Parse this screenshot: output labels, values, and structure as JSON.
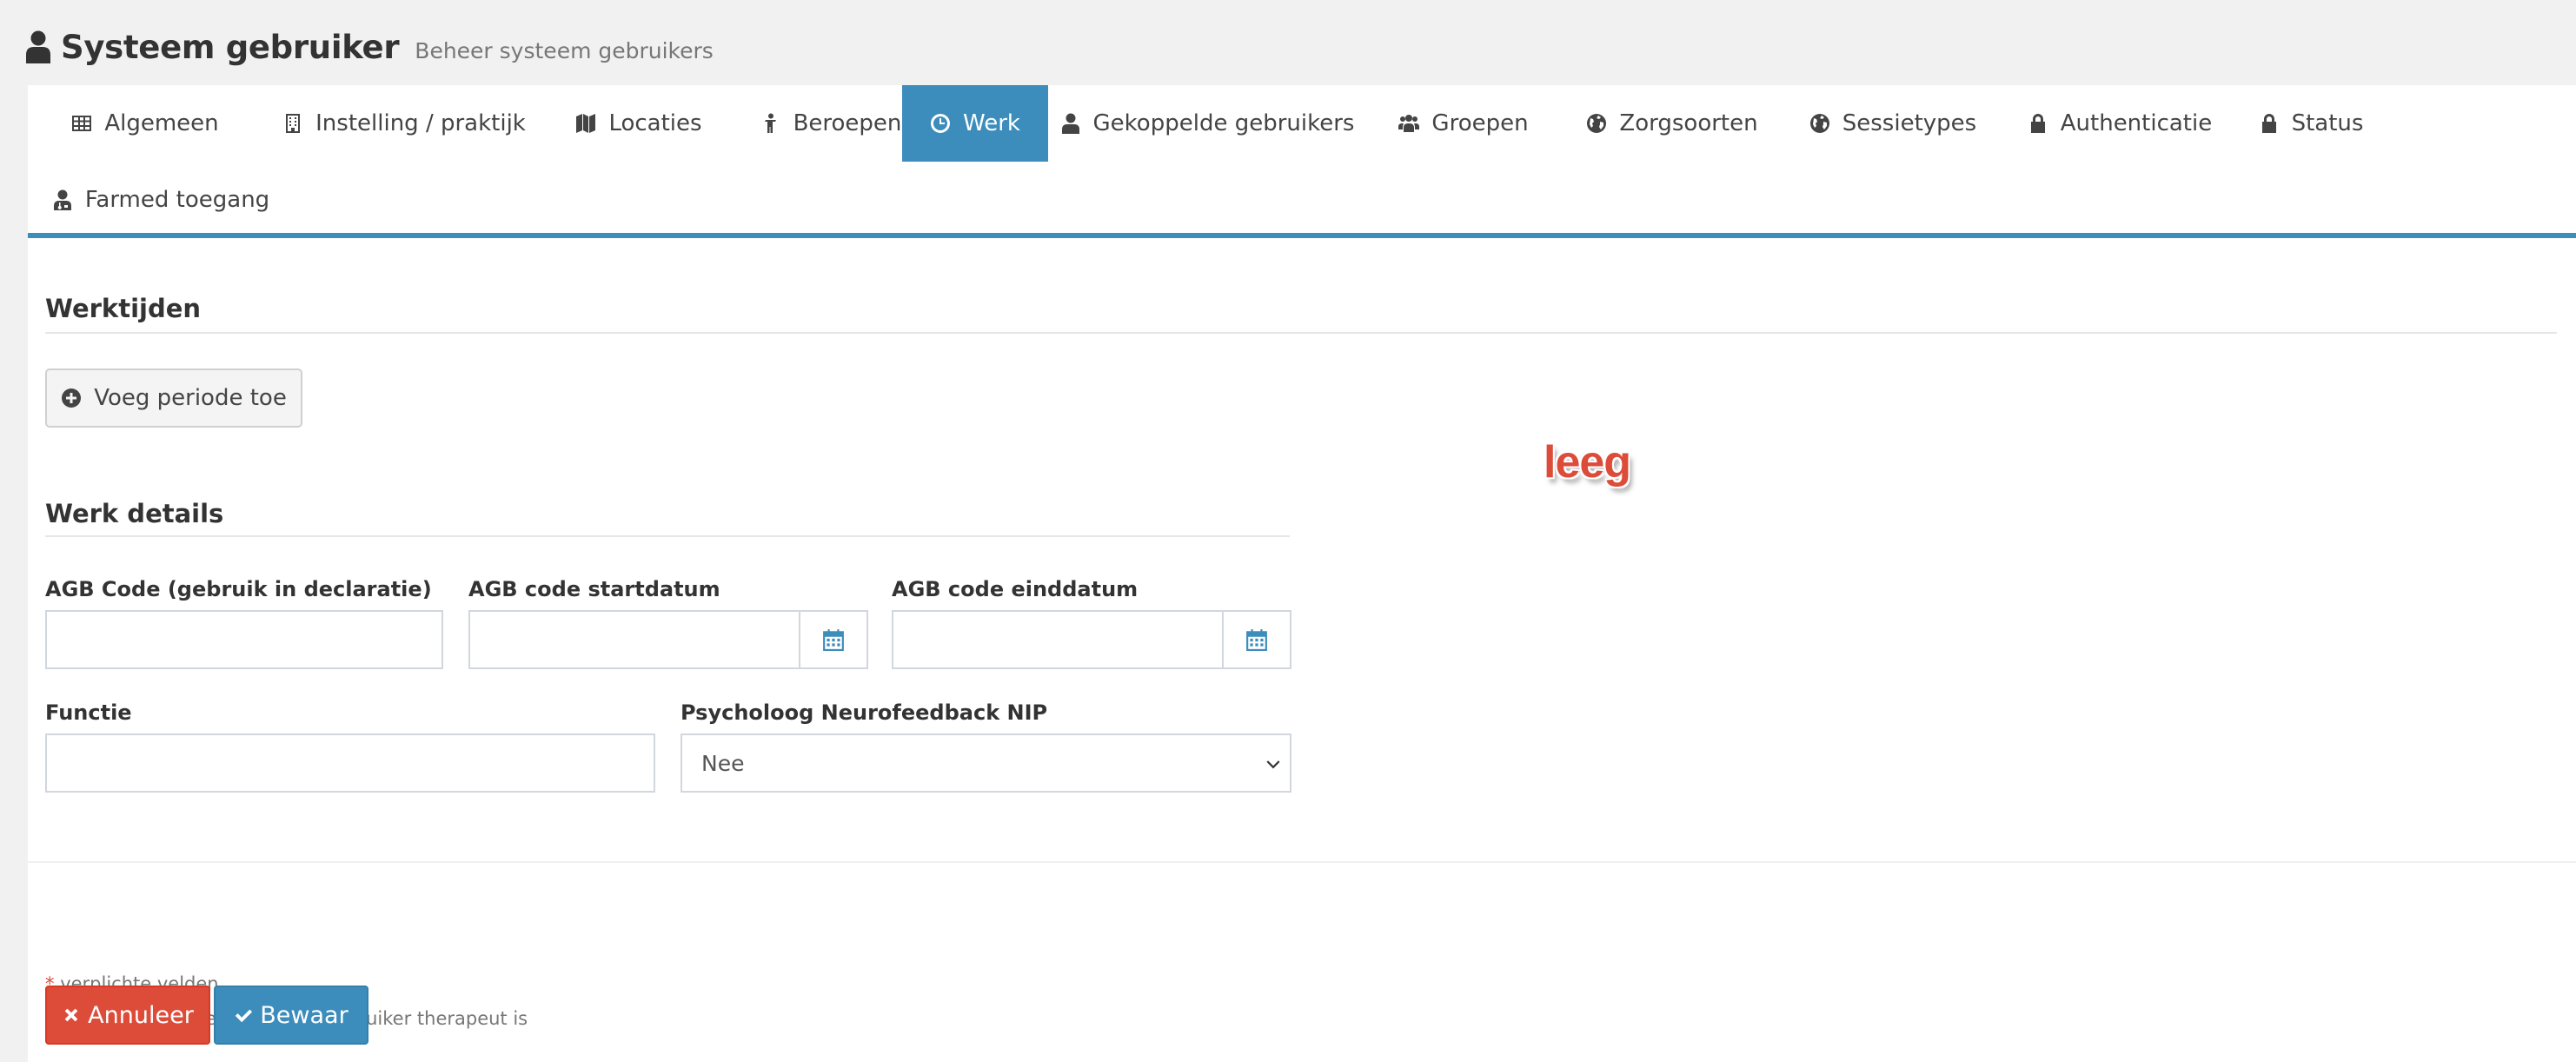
{
  "header": {
    "title": "Systeem gebruiker",
    "subtitle": "Beheer systeem gebruikers",
    "icon": "user-icon"
  },
  "tabs": [
    {
      "label": "Algemeen",
      "icon": "table-icon",
      "active": false
    },
    {
      "label": "Instelling / praktijk",
      "icon": "building-icon",
      "active": false
    },
    {
      "label": "Locaties",
      "icon": "map-icon",
      "active": false
    },
    {
      "label": "Beroepen",
      "icon": "person-icon",
      "active": false
    },
    {
      "label": "Werk",
      "icon": "clock-icon",
      "active": true
    },
    {
      "label": "Gekoppelde gebruikers",
      "icon": "user-icon",
      "active": false
    },
    {
      "label": "Groepen",
      "icon": "users-icon",
      "active": false
    },
    {
      "label": "Zorgsoorten",
      "icon": "globe-icon",
      "active": false
    },
    {
      "label": "Sessietypes",
      "icon": "globe-icon",
      "active": false
    },
    {
      "label": "Authenticatie",
      "icon": "lock-icon",
      "active": false
    },
    {
      "label": "Status",
      "icon": "lock-icon",
      "active": false
    },
    {
      "label": "Farmed toegang",
      "icon": "user-md-icon",
      "active": false
    }
  ],
  "worktimes": {
    "title": "Werktijden",
    "add_period_label": "Voeg periode toe",
    "empty_label": "leeg"
  },
  "work_details": {
    "title": "Werk details",
    "agb_code": {
      "label": "AGB Code (gebruik in declaratie)",
      "value": ""
    },
    "agb_start": {
      "label": "AGB code startdatum",
      "value": ""
    },
    "agb_end": {
      "label": "AGB code einddatum",
      "value": ""
    },
    "function": {
      "label": "Functie",
      "value": ""
    },
    "nip": {
      "label": "Psycholoog Neurofeedback NIP",
      "value": "Nee"
    }
  },
  "footer": {
    "required_marker": "*",
    "required_note": "verplichte velden",
    "therapist_marker": "**",
    "therapist_note": "verplichte velden indien de gebruiker therapeut is",
    "cancel_label": "Annuleer",
    "save_label": "Bewaar"
  },
  "colors": {
    "accent": "#3c8dbc",
    "danger": "#dd4b39"
  }
}
